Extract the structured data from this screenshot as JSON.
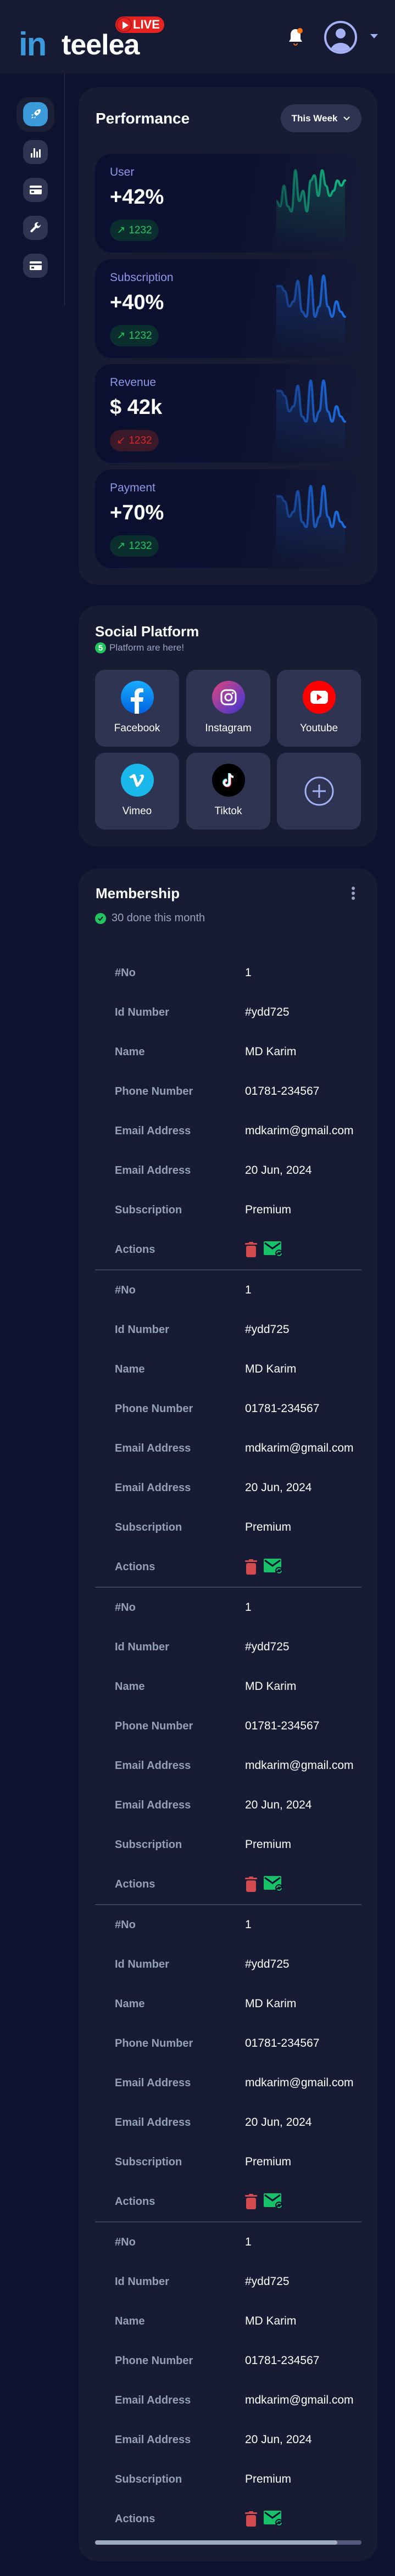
{
  "header": {
    "logo": {
      "prefix": "in",
      "word": "teelea",
      "badge": "LIVE"
    },
    "notification_dot_color": "#f97316"
  },
  "sidebar": {
    "items": [
      {
        "icon": "rocket-icon",
        "active": true
      },
      {
        "icon": "bar-chart-icon",
        "active": false
      },
      {
        "icon": "credit-card-icon",
        "active": false
      },
      {
        "icon": "wrench-icon",
        "active": false
      },
      {
        "icon": "credit-card-icon",
        "active": false
      }
    ]
  },
  "performance": {
    "title": "Performance",
    "period": "This Week",
    "stats": [
      {
        "label": "User",
        "value": "+42%",
        "change": "1232",
        "direction": "up",
        "color": "#10b981",
        "trend": [
          3,
          2,
          6,
          2,
          1,
          9,
          3,
          5,
          1,
          7,
          8,
          4,
          9,
          6,
          4,
          5,
          7,
          6,
          7
        ]
      },
      {
        "label": "Subscription",
        "value": "+40%",
        "change": "1232",
        "direction": "up",
        "color": "#1d6fe8",
        "trend": [
          7,
          7,
          6,
          3,
          4,
          8,
          2,
          1,
          9,
          1,
          3,
          9,
          3,
          1,
          4,
          2,
          1
        ]
      },
      {
        "label": "Revenue",
        "value": "$ 42k",
        "change": "1232",
        "direction": "down",
        "color": "#1d6fe8",
        "trend": [
          7,
          7,
          6,
          3,
          4,
          8,
          2,
          1,
          9,
          1,
          3,
          9,
          3,
          1,
          4,
          2,
          1
        ]
      },
      {
        "label": "Payment",
        "value": "+70%",
        "change": "1232",
        "direction": "up",
        "color": "#1d6fe8",
        "trend": [
          7,
          7,
          6,
          3,
          4,
          8,
          2,
          1,
          9,
          1,
          3,
          9,
          3,
          1,
          4,
          2,
          1
        ]
      }
    ]
  },
  "social": {
    "title": "Social Platform",
    "count": "5",
    "subtitle": "Platform are here!",
    "platforms": [
      {
        "label": "Facebook",
        "icon": "facebook-icon"
      },
      {
        "label": "Instagram",
        "icon": "instagram-icon"
      },
      {
        "label": "Youtube",
        "icon": "youtube-icon"
      },
      {
        "label": "Vimeo",
        "icon": "vimeo-icon"
      },
      {
        "label": "Tiktok",
        "icon": "tiktok-icon"
      }
    ]
  },
  "membership": {
    "title": "Membership",
    "subtitle": "30 done this month",
    "labels": [
      "#No",
      "Id Number",
      "Name",
      "Phone Number",
      "Email Address",
      "Email Address",
      "Subscription",
      "Actions"
    ],
    "records": [
      {
        "no": "1",
        "id": "#ydd725",
        "name": "MD Karim",
        "phone": "01781-234567",
        "email": "mdkarim@gmail.com",
        "date": "20 Jun, 2024",
        "subscription": "Premium"
      },
      {
        "no": "1",
        "id": "#ydd725",
        "name": "MD Karim",
        "phone": "01781-234567",
        "email": "mdkarim@gmail.com",
        "date": "20 Jun, 2024",
        "subscription": "Premium"
      },
      {
        "no": "1",
        "id": "#ydd725",
        "name": "MD Karim",
        "phone": "01781-234567",
        "email": "mdkarim@gmail.com",
        "date": "20 Jun, 2024",
        "subscription": "Premium"
      },
      {
        "no": "1",
        "id": "#ydd725",
        "name": "MD Karim",
        "phone": "01781-234567",
        "email": "mdkarim@gmail.com",
        "date": "20 Jun, 2024",
        "subscription": "Premium"
      },
      {
        "no": "1",
        "id": "#ydd725",
        "name": "MD Karim",
        "phone": "01781-234567",
        "email": "mdkarim@gmail.com",
        "date": "20 Jun, 2024",
        "subscription": "Premium"
      }
    ],
    "scroll_position": 0.91
  }
}
